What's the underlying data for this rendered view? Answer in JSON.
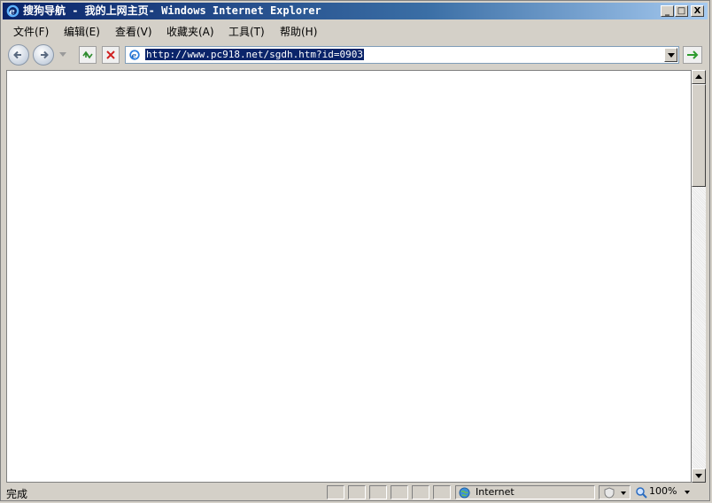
{
  "window": {
    "title": "搜狗导航 - 我的上网主页- Windows Internet Explorer",
    "minimize": "_",
    "maximize": "□",
    "close": "X"
  },
  "menu": {
    "items": [
      {
        "label": "文件(F)"
      },
      {
        "label": "编辑(E)"
      },
      {
        "label": "查看(V)"
      },
      {
        "label": "收藏夹(A)"
      },
      {
        "label": "工具(T)"
      },
      {
        "label": "帮助(H)"
      }
    ]
  },
  "address": {
    "url": "http://www.pc918.net/sgdh.htm?id=0903"
  },
  "status": {
    "text": "完成",
    "zone": "Internet",
    "zoom": "100%"
  },
  "colors": {
    "title_start": "#0a246a",
    "title_end": "#a6caf0",
    "selection": "#0a246a",
    "chrome": "#d4d0c8"
  },
  "icons": {
    "ie": "ie-logo-icon",
    "back": "back-arrow-icon",
    "forward": "forward-arrow-icon",
    "refresh": "refresh-icon",
    "stop": "stop-icon",
    "go": "go-arrow-icon",
    "globe": "globe-icon",
    "zoom": "magnifier-icon",
    "protected": "shield-icon"
  }
}
